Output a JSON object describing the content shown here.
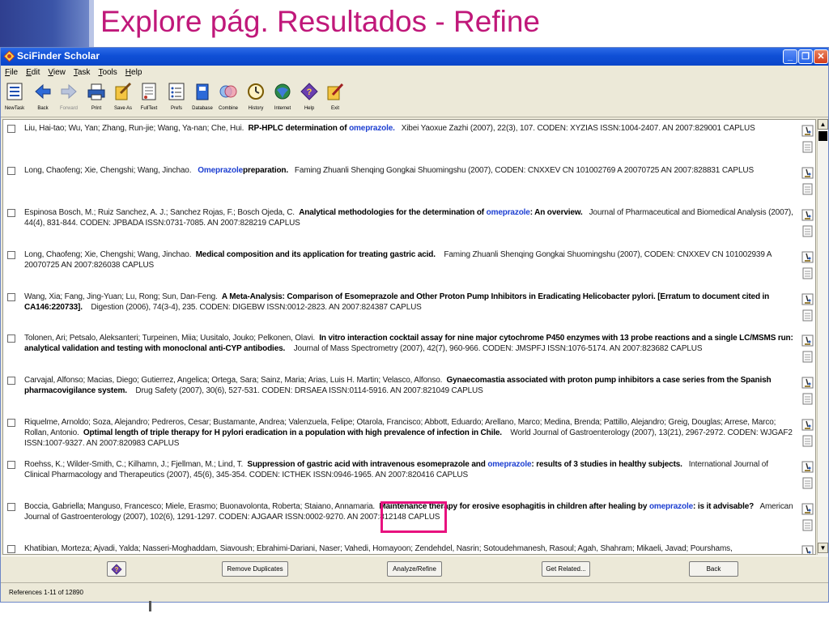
{
  "slide": {
    "title": "Explore pág. Resultados - Refine",
    "title_color": "#c0187a",
    "accent_color": "#3b55a8"
  },
  "window": {
    "title": "SciFinder Scholar",
    "controls": [
      "minimize-icon",
      "maximize-icon",
      "close-icon"
    ]
  },
  "menu": [
    "File",
    "Edit",
    "View",
    "Task",
    "Tools",
    "Help"
  ],
  "toolbar": [
    {
      "label": "NewTask",
      "icon": "new-task-icon",
      "enabled": true
    },
    {
      "label": "Back",
      "icon": "back-arrow-icon",
      "enabled": true
    },
    {
      "label": "Forward",
      "icon": "forward-arrow-icon",
      "enabled": false
    },
    {
      "label": "Print",
      "icon": "printer-icon",
      "enabled": true
    },
    {
      "label": "Save As",
      "icon": "save-as-icon",
      "enabled": true
    },
    {
      "label": "FullText",
      "icon": "full-text-icon",
      "enabled": true
    },
    {
      "label": "Prefs",
      "icon": "preferences-icon",
      "enabled": true
    },
    {
      "label": "Database",
      "icon": "database-icon",
      "enabled": true
    },
    {
      "label": "Combine",
      "icon": "combine-icon",
      "enabled": true
    },
    {
      "label": "History",
      "icon": "history-icon",
      "enabled": true
    },
    {
      "label": "Internet",
      "icon": "globe-icon",
      "enabled": true
    },
    {
      "label": "Help",
      "icon": "help-icon",
      "enabled": true
    },
    {
      "label": "Exit",
      "icon": "exit-icon",
      "enabled": true
    }
  ],
  "results": [
    {
      "authors": "Liu, Hai-tao; Wu, Yan; Zhang, Run-jie; Wang, Ya-nan; Che, Hui.",
      "title_pre": "RP-HPLC determination of",
      "title_hl": "omeprazole.",
      "title_post": "",
      "source": "Xibei Yaoxue Zazhi  (2007),  22(3),  107.  CODEN: XYZIAS  ISSN:1004-2407.  AN 2007:829001    CAPLUS"
    },
    {
      "authors": "Long, Chaofeng; Xie, Chengshi; Wang, Jinchao.",
      "title_pre": "",
      "title_hl": "Omeprazole",
      "title_post": "preparation.",
      "source": "Faming Zhuanli Shenqing Gongkai Shuomingshu  (2007),      CODEN: CNXXEV  CN  101002769  A  20070725  AN 2007:828831    CAPLUS"
    },
    {
      "authors": "Espinosa Bosch, M.; Ruiz Sanchez, A. J.; Sanchez Rojas, F.; Bosch Ojeda, C.",
      "title_pre": "Analytical methodologies for the determination of",
      "title_hl": "omeprazole",
      "title_post": ": An overview.",
      "source": "Journal of Pharmaceutical and Biomedical Analysis  (2007),  44(4),  831-844.  CODEN: JPBADA  ISSN:0731-7085.  AN 2007:828219    CAPLUS"
    },
    {
      "authors": "Long, Chaofeng; Xie, Chengshi; Wang, Jinchao.",
      "title_pre": "Medical composition and its application for treating gastric acid.",
      "title_hl": "",
      "title_post": "",
      "source": "Faming Zhuanli Shenqing Gongkai Shuomingshu  (2007),      CODEN: CNXXEV  CN 101002939  A  20070725  AN 2007:826038    CAPLUS"
    },
    {
      "authors": "Wang, Xia; Fang, Jing-Yuan; Lu, Rong; Sun, Dan-Feng.",
      "title_pre": "A Meta-Analysis: Comparison of Esomeprazole and Other Proton Pump Inhibitors in Eradicating Helicobacter pylori. [Erratum to document cited in CA146:220733].",
      "title_hl": "",
      "title_post": "",
      "source": "Digestion  (2006),  74(3-4),  235.  CODEN: DIGEBW  ISSN:0012-2823.  AN 2007:824387    CAPLUS"
    },
    {
      "authors": "Tolonen, Ari; Petsalo, Aleksanteri; Turpeinen, Miia; Uusitalo, Jouko; Pelkonen, Olavi.",
      "title_pre": "In vitro interaction cocktail assay for nine major cytochrome P450 enzymes with 13 probe reactions and a single LC/MSMS run: analytical validation and testing with monoclonal anti-CYP antibodies.",
      "title_hl": "",
      "title_post": "",
      "source": "Journal of Mass Spectrometry  (2007),  42(7),  960-966.  CODEN: JMSPFJ  ISSN:1076-5174.  AN 2007:823682    CAPLUS"
    },
    {
      "authors": "Carvajal, Alfonso; Macias, Diego; Gutierrez, Angelica; Ortega, Sara; Sainz, Maria; Arias, Luis H. Martin; Velasco, Alfonso.",
      "title_pre": "Gynaecomastia associated with proton pump inhibitors a case series from the Spanish pharmacovigilance system.",
      "title_hl": "",
      "title_post": "",
      "source": "Drug Safety  (2007),  30(6),  527-531.  CODEN: DRSAEA  ISSN:0114-5916.  AN 2007:821049    CAPLUS"
    },
    {
      "authors": "Riquelme, Arnoldo; Soza, Alejandro; Pedreros, Cesar; Bustamante, Andrea; Valenzuela, Felipe; Otarola, Francisco; Abbott, Eduardo; Arellano, Marco; Medina, Brenda; Pattillo, Alejandro; Greig, Douglas; Arrese, Marco; Rollan, Antonio.",
      "title_pre": "Optimal length of triple therapy for H pylori eradication in a population with high prevalence of infection in Chile.",
      "title_hl": "",
      "title_post": "",
      "source": "World Journal of Gastroenterology  (2007),  13(21),  2967-2972.  CODEN: WJGAF2  ISSN:1007-9327.  AN 2007:820983    CAPLUS"
    },
    {
      "authors": "Roehss, K.; Wilder-Smith, C.; Kilhamn, J.; Fjellman, M.; Lind, T.",
      "title_pre": "Suppression of gastric acid with intravenous esomeprazole and",
      "title_hl": "omeprazole",
      "title_post": ": results of 3 studies in healthy subjects.",
      "source": "International Journal of Clinical Pharmacology and Therapeutics  (2007),  45(6),  345-354.  CODEN: ICTHEK  ISSN:0946-1965.  AN 2007:820416    CAPLUS"
    },
    {
      "authors": "Boccia, Gabriella; Manguso, Francesco; Miele, Erasmo; Buonavolonta, Roberta; Staiano, Annamaria.",
      "title_pre": "Maintenance therapy for erosive esophagitis in children after healing by",
      "title_hl": "omeprazole",
      "title_post": ": is it advisable?",
      "source": "American Journal of Gastroenterology  (2007),  102(6),  1291-1297.  CODEN: AJGAAR  ISSN:0002-9270.  AN 2007:812148    CAPLUS"
    },
    {
      "authors": "Khatibian, Morteza; Ajvadi, Yalda; Nasseri-Moghaddam, Siavoush; Ebrahimi-Dariani, Naser; Vahedi, Homayoon; Zendehdel, Nasrin; Sotoudehmanesh, Rasoul; Agah, Shahram; Mikaeli, Javad; Pourshams,",
      "title_pre": "",
      "title_hl": "",
      "title_post": "",
      "source": ""
    }
  ],
  "result_icons": [
    "microscope-icon",
    "document-icon"
  ],
  "buttons": {
    "help_icon": "help-diamond-icon",
    "remove_duplicates": "Remove Duplicates",
    "analyze_refine": "Analyze/Refine",
    "get_related": "Get Related...",
    "back": "Back"
  },
  "highlight_color": "#e8127f",
  "status": {
    "text": "References 1-11 of 12890"
  }
}
